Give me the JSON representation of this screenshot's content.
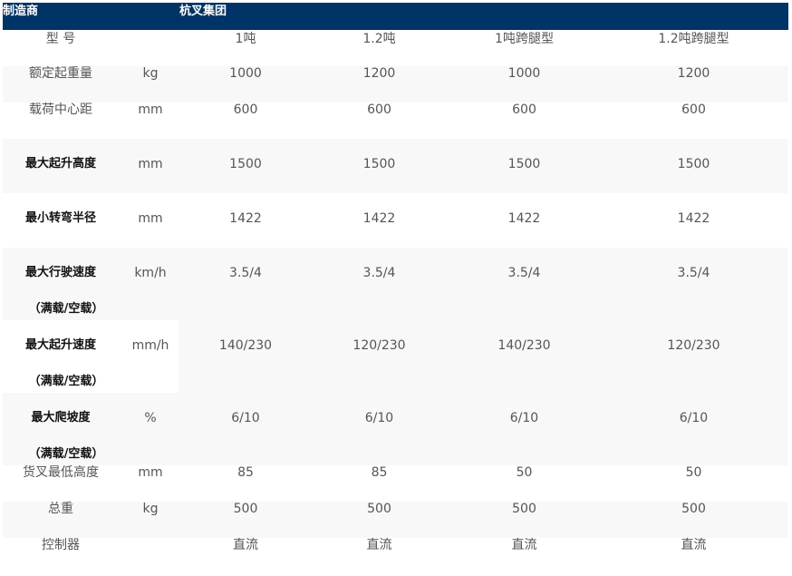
{
  "header": {
    "manufacturer_label": "制造商",
    "manufacturer_value": "杭叉集团"
  },
  "table": {
    "model_row": {
      "label": "型 号",
      "unit": "",
      "values": [
        "1吨",
        "1.2吨",
        "1吨跨腿型",
        "1.2吨跨腿型"
      ]
    },
    "rated_load": {
      "label": "额定起重量",
      "unit": "kg",
      "values": [
        "1000",
        "1200",
        "1000",
        "1200"
      ]
    },
    "load_center": {
      "label": "载荷中心距",
      "unit": "mm",
      "values": [
        "600",
        "600",
        "600",
        "600"
      ]
    },
    "max_lift_height": {
      "label": "最大起升高度",
      "unit": "mm",
      "values": [
        "1500",
        "1500",
        "1500",
        "1500"
      ]
    },
    "min_turning_radius": {
      "label": "最小转弯半径",
      "unit": "mm",
      "values": [
        "1422",
        "1422",
        "1422",
        "1422"
      ]
    },
    "max_travel_speed": {
      "label": "最大行驶速度",
      "sub": "（满载/空载）",
      "unit": "km/h",
      "values": [
        "3.5/4",
        "3.5/4",
        "3.5/4",
        "3.5/4"
      ]
    },
    "max_lift_speed": {
      "label": "最大起升速度",
      "sub": "（满载/空载）",
      "unit": "mm/h",
      "values": [
        "140/230",
        "120/230",
        "140/230",
        "120/230"
      ]
    },
    "max_gradeability": {
      "label": "最大爬坡度",
      "sub": "（满载/空载）",
      "unit": "%",
      "values": [
        "6/10",
        "6/10",
        "6/10",
        "6/10"
      ]
    },
    "min_fork_height": {
      "label": "货叉最低高度",
      "unit": "mm",
      "values": [
        "85",
        "85",
        "50",
        "50"
      ]
    },
    "total_weight": {
      "label": "总重",
      "unit": "kg",
      "values": [
        "500",
        "500",
        "500",
        "500"
      ]
    },
    "controller": {
      "label": "控制器",
      "unit": "",
      "values": [
        "直流",
        "直流",
        "直流",
        "直流"
      ]
    }
  }
}
